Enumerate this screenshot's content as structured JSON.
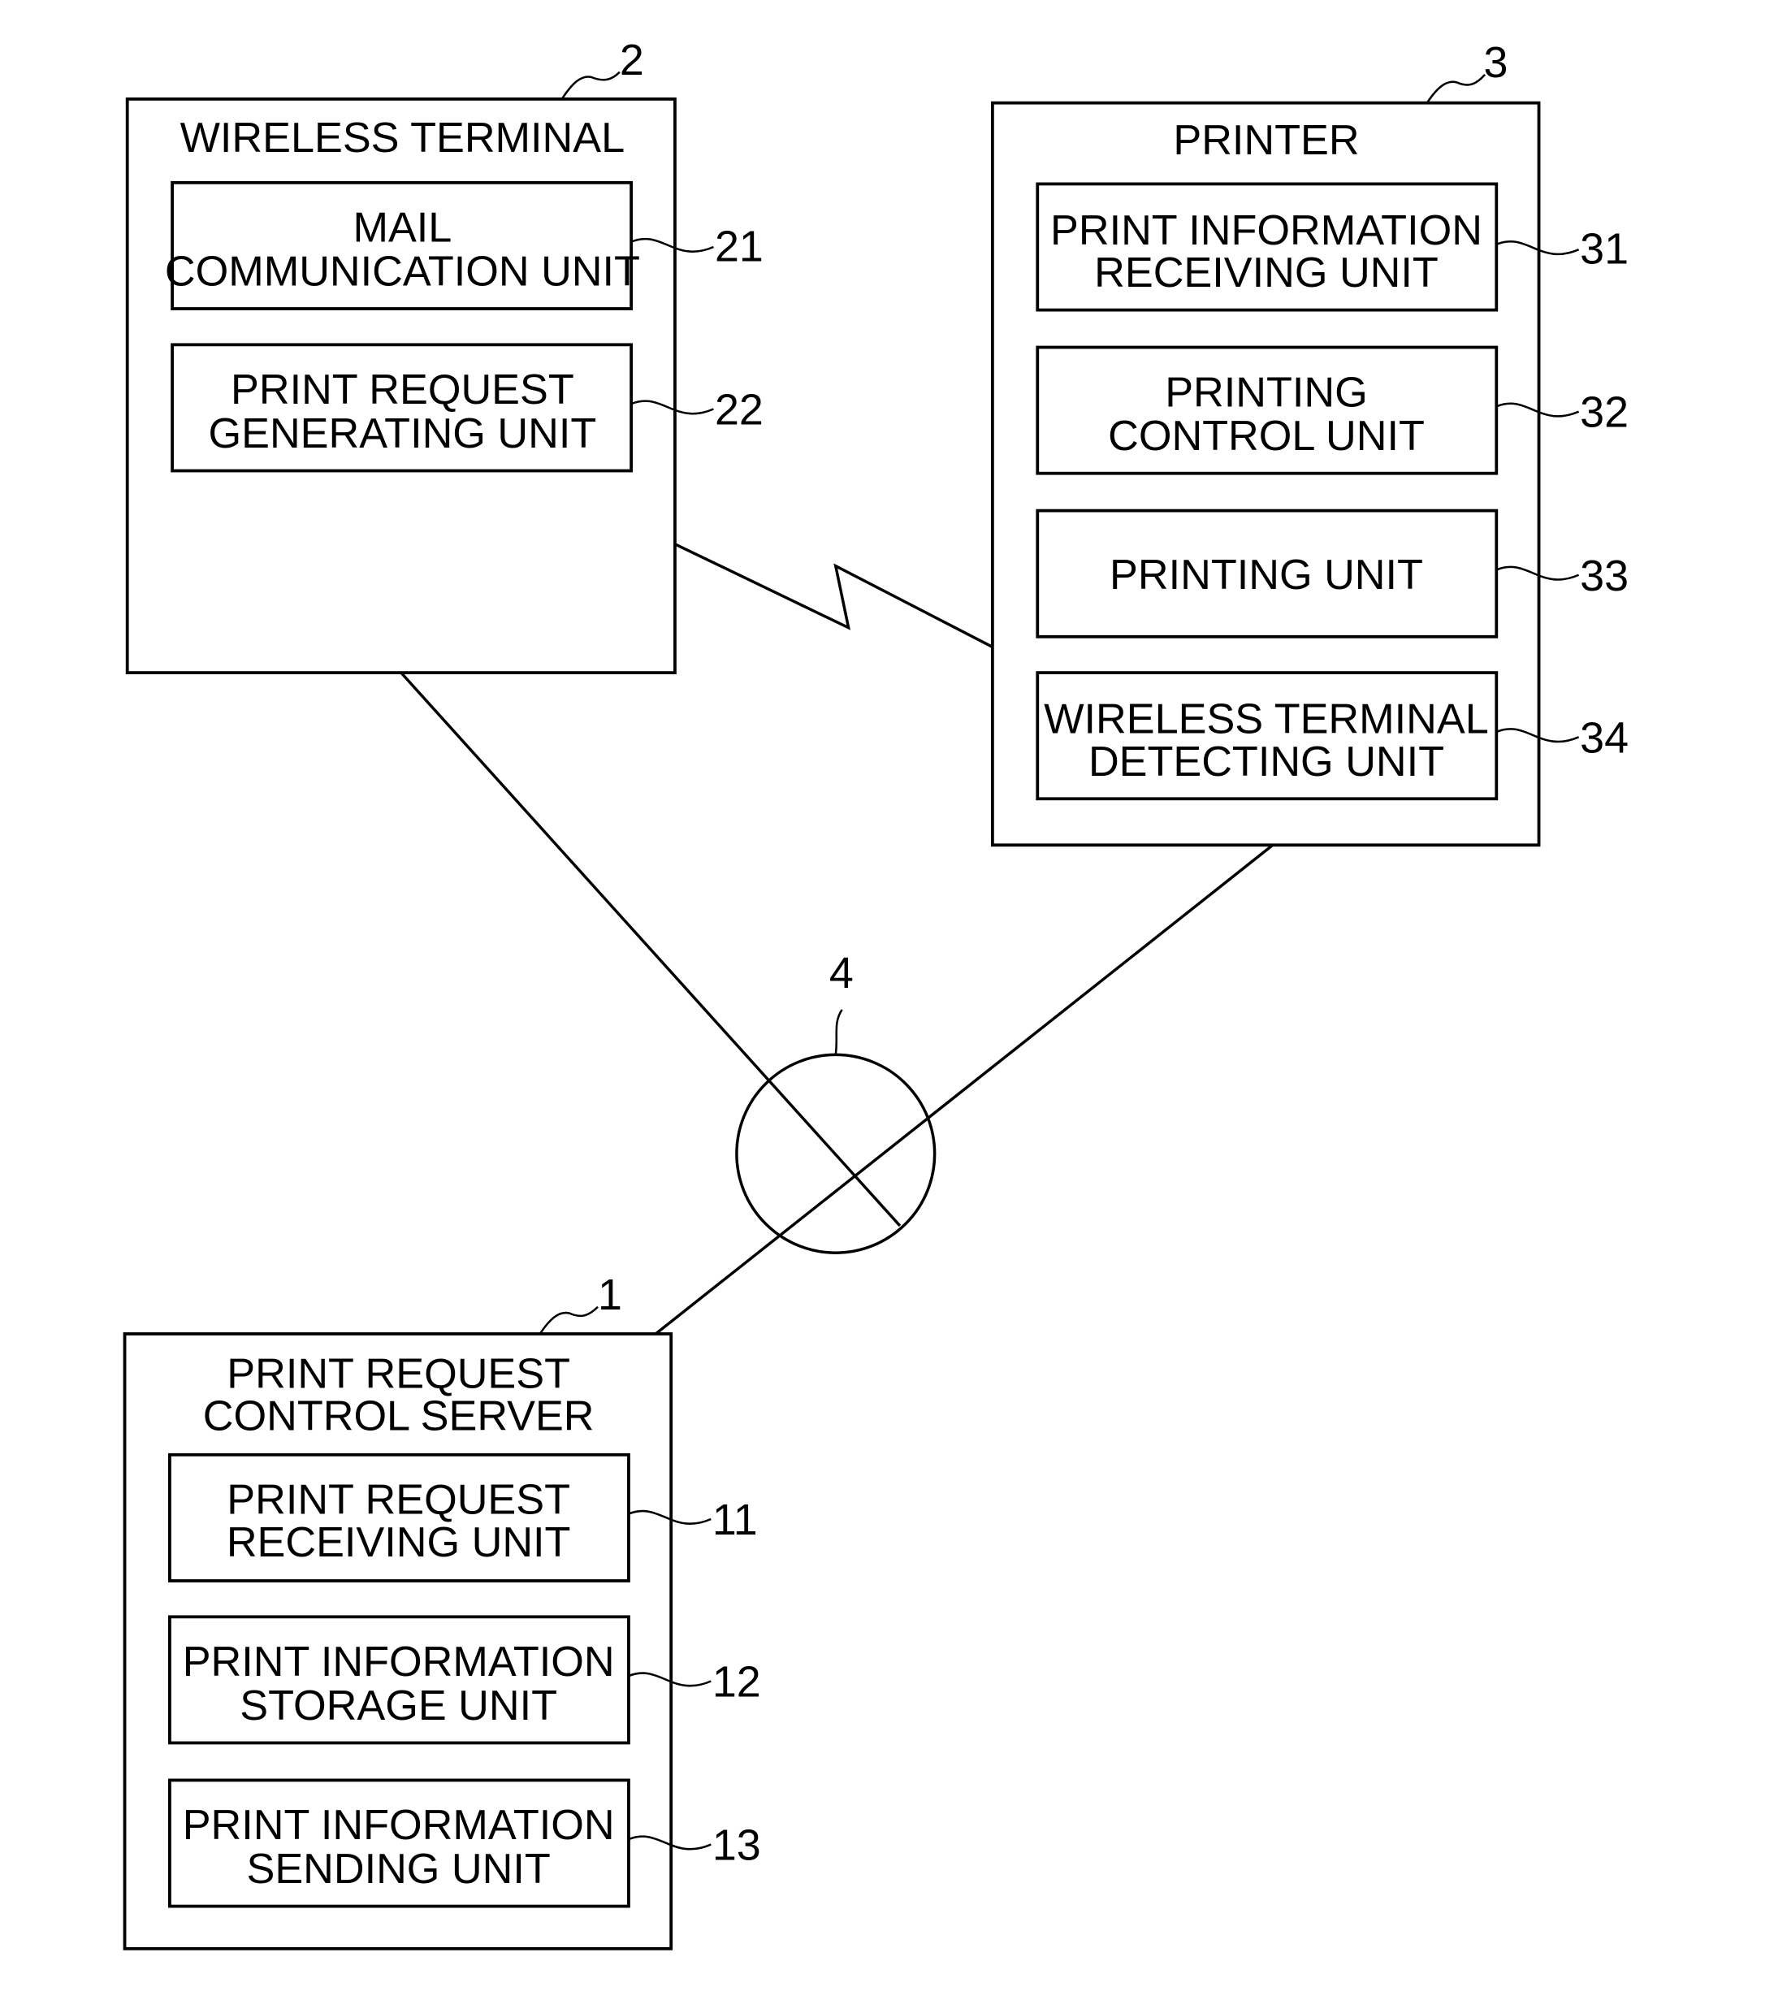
{
  "diagram": {
    "network": {
      "ref": "4"
    },
    "wireless_terminal": {
      "ref": "2",
      "title": "WIRELESS TERMINAL",
      "units": [
        {
          "ref": "21",
          "lines": [
            "MAIL",
            "COMMUNICATION UNIT"
          ]
        },
        {
          "ref": "22",
          "lines": [
            "PRINT REQUEST",
            "GENERATING UNIT"
          ]
        }
      ]
    },
    "printer": {
      "ref": "3",
      "title": "PRINTER",
      "units": [
        {
          "ref": "31",
          "lines": [
            "PRINT INFORMATION",
            "RECEIVING UNIT"
          ]
        },
        {
          "ref": "32",
          "lines": [
            "PRINTING",
            "CONTROL UNIT"
          ]
        },
        {
          "ref": "33",
          "lines": [
            "PRINTING UNIT"
          ]
        },
        {
          "ref": "34",
          "lines": [
            "WIRELESS TERMINAL",
            "DETECTING UNIT"
          ]
        }
      ]
    },
    "server": {
      "ref": "1",
      "title": [
        "PRINT REQUEST",
        "CONTROL SERVER"
      ],
      "units": [
        {
          "ref": "11",
          "lines": [
            "PRINT REQUEST",
            "RECEIVING UNIT"
          ]
        },
        {
          "ref": "12",
          "lines": [
            "PRINT INFORMATION",
            "STORAGE UNIT"
          ]
        },
        {
          "ref": "13",
          "lines": [
            "PRINT INFORMATION",
            "SENDING UNIT"
          ]
        }
      ]
    }
  }
}
